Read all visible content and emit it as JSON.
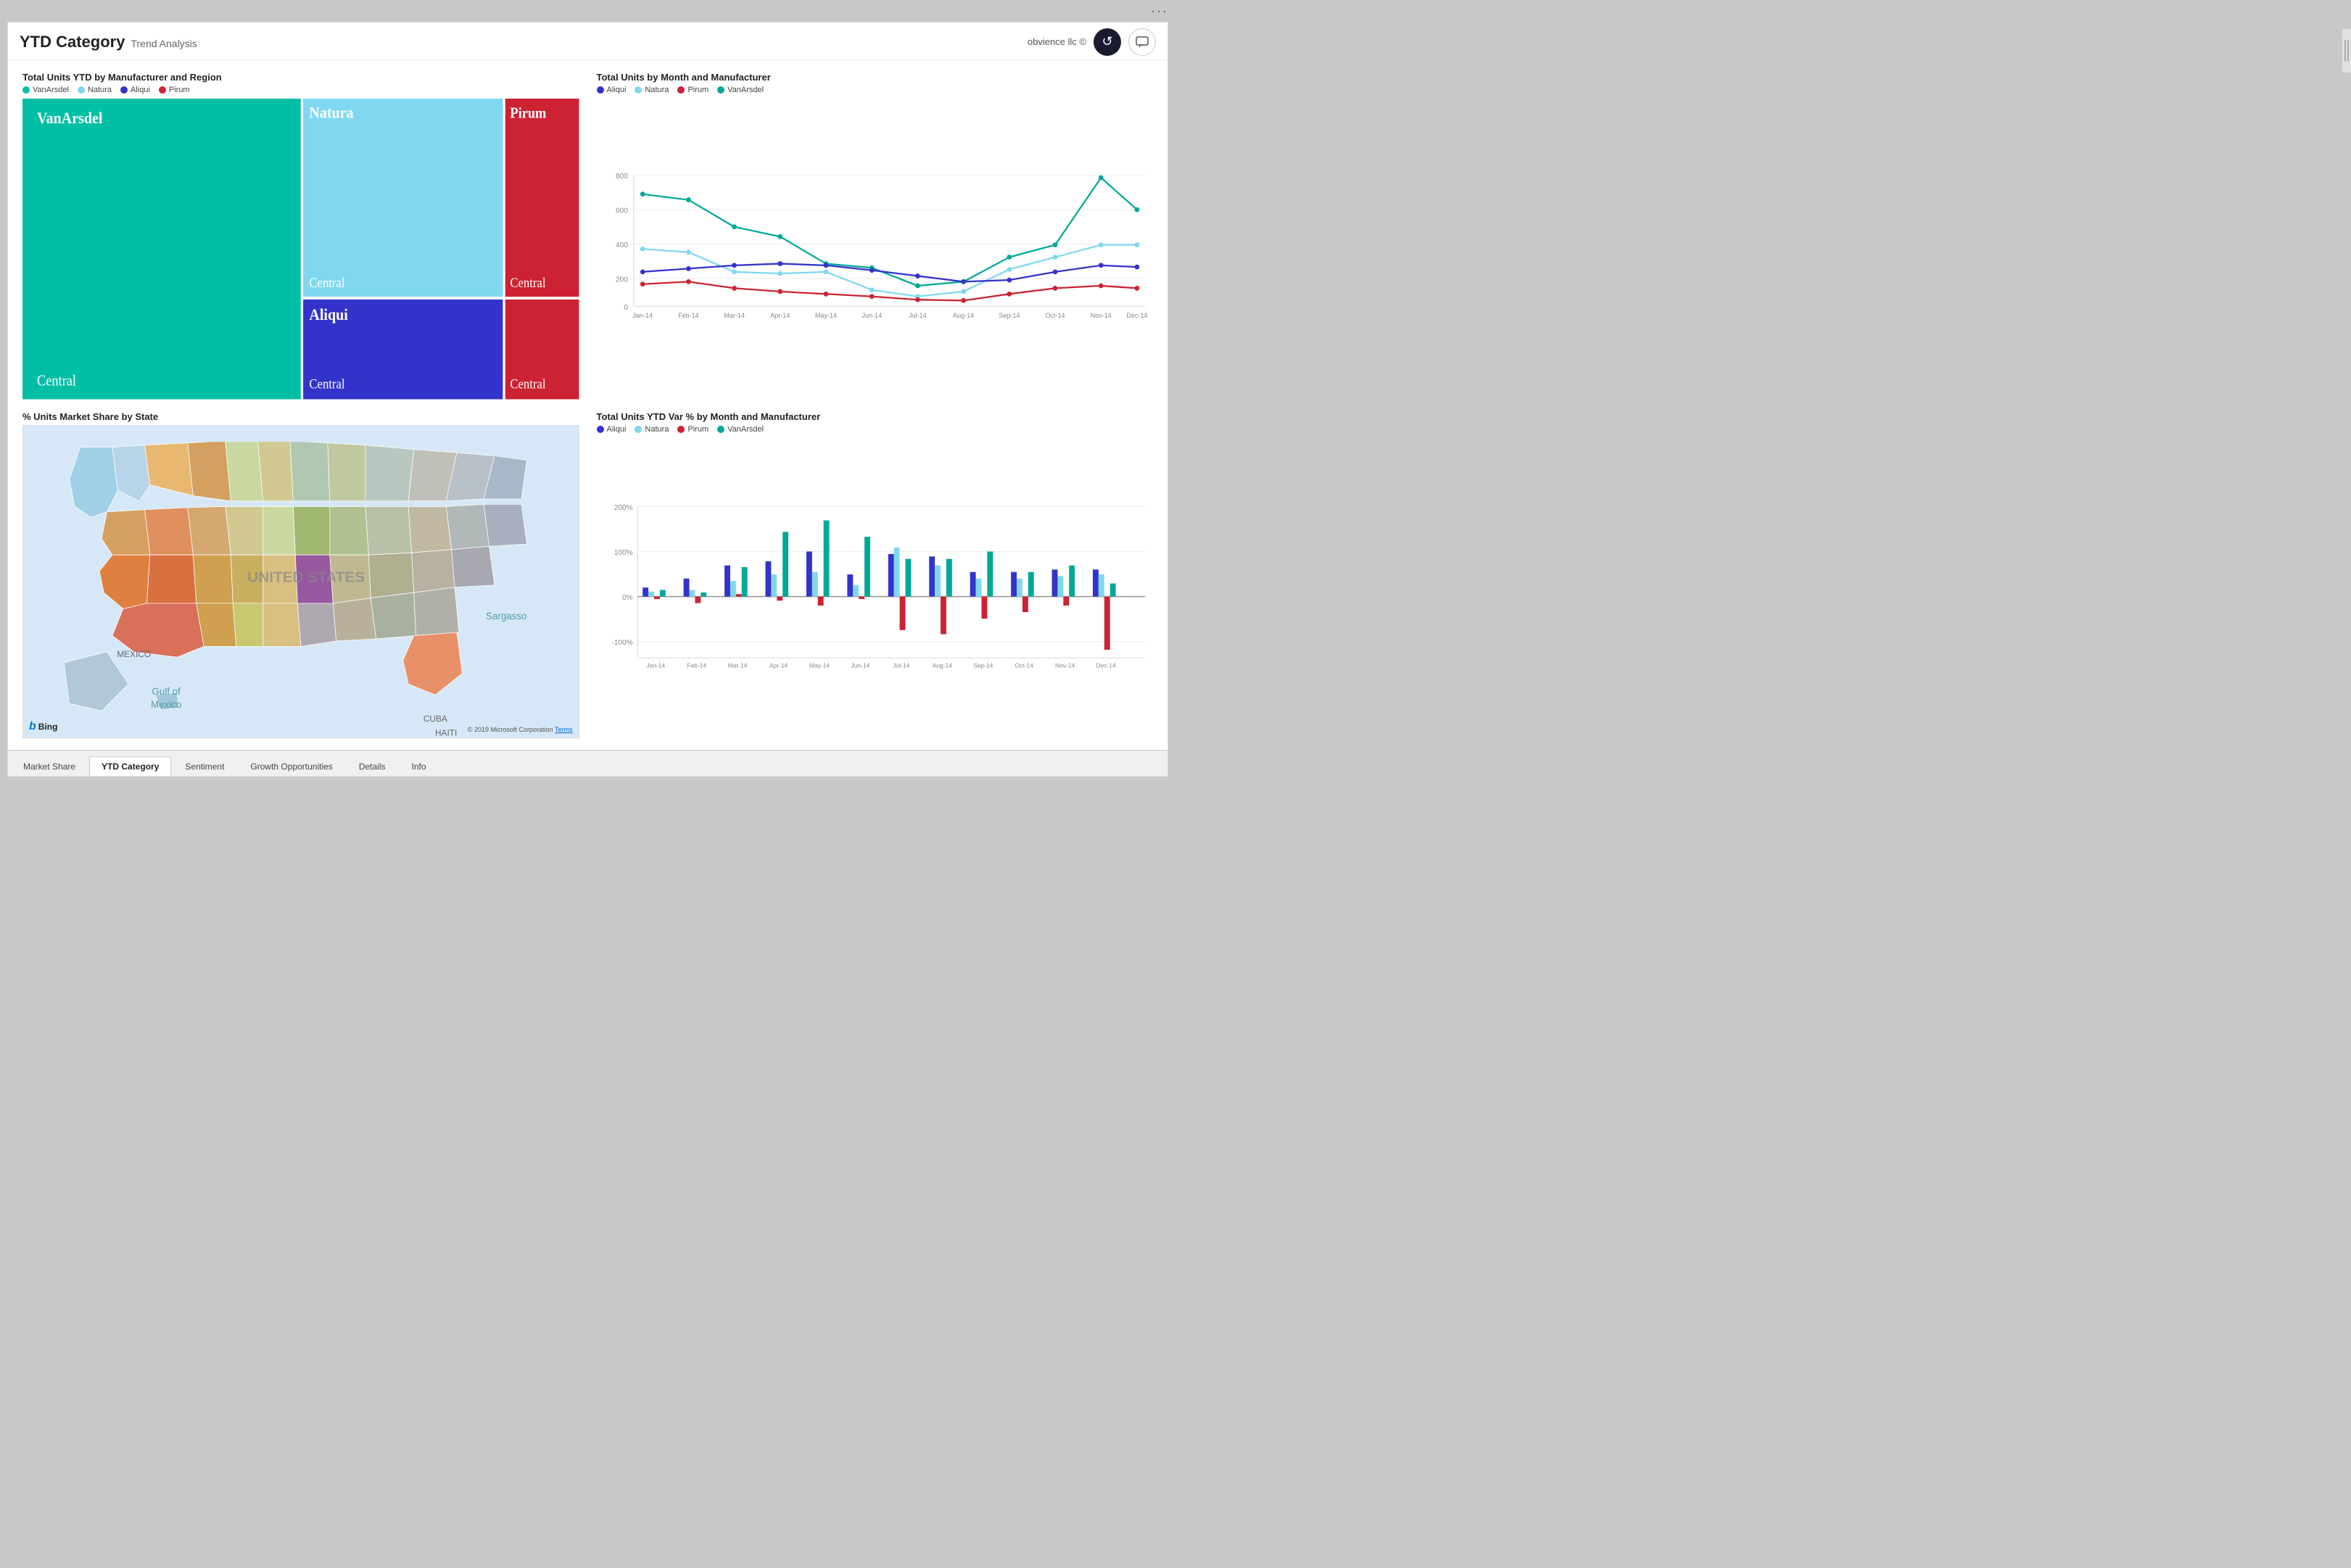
{
  "header": {
    "title_main": "YTD Category",
    "title_sub": "Trend Analysis",
    "brand": "obvience llc ©"
  },
  "panels": {
    "top_left": {
      "title": "Total Units YTD by Manufacturer and Region",
      "legend": [
        {
          "label": "VanArsdel",
          "color": "#00bfa5"
        },
        {
          "label": "Natura",
          "color": "#80d8f0"
        },
        {
          "label": "Aliqui",
          "color": "#3333cc"
        },
        {
          "label": "Pirum",
          "color": "#cc2233"
        }
      ]
    },
    "top_right": {
      "title": "Total Units by Month and Manufacturer",
      "legend": [
        {
          "label": "Aliqui",
          "color": "#3333cc"
        },
        {
          "label": "Natura",
          "color": "#80d8f0"
        },
        {
          "label": "Pirum",
          "color": "#cc2233"
        },
        {
          "label": "VanArsdel",
          "color": "#00a896"
        }
      ],
      "y_labels": [
        "800",
        "600",
        "400",
        "200",
        "0"
      ],
      "x_labels": [
        "Jan-14",
        "Feb-14",
        "Mar-14",
        "Apr-14",
        "May-14",
        "Jun-14",
        "Jul-14",
        "Aug-14",
        "Sep-14",
        "Oct-14",
        "Nov-14",
        "Dec-14"
      ]
    },
    "bottom_left": {
      "title": "% Units Market Share by State"
    },
    "bottom_right": {
      "title": "Total Units YTD Var % by Month and Manufacturer",
      "legend": [
        {
          "label": "Aliqui",
          "color": "#3333cc"
        },
        {
          "label": "Natura",
          "color": "#80d8f0"
        },
        {
          "label": "Pirum",
          "color": "#cc2233"
        },
        {
          "label": "VanArsdel",
          "color": "#00a896"
        }
      ],
      "y_labels": [
        "200%",
        "100%",
        "0%",
        "-100%"
      ],
      "x_labels": [
        "Jan-14",
        "Feb-14",
        "Mar-14",
        "Apr-14",
        "May-14",
        "Jun-14",
        "Jul-14",
        "Aug-14",
        "Sep-14",
        "Oct-14",
        "Nov-14",
        "Dec-14"
      ]
    }
  },
  "tabs": [
    {
      "label": "Market Share",
      "active": false
    },
    {
      "label": "YTD Category",
      "active": true
    },
    {
      "label": "Sentiment",
      "active": false
    },
    {
      "label": "Growth Opportunities",
      "active": false
    },
    {
      "label": "Details",
      "active": false
    },
    {
      "label": "Info",
      "active": false
    }
  ],
  "icons": {
    "refresh": "↺",
    "chat": "💬",
    "dots": "···",
    "bing_b": "b"
  }
}
